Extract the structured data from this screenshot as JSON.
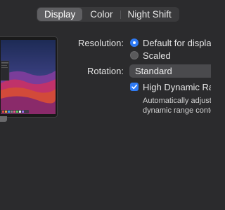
{
  "tabs": [
    {
      "label": "Display",
      "active": true
    },
    {
      "label": "Color",
      "active": false
    },
    {
      "label": "Night Shift",
      "active": false
    }
  ],
  "display": {
    "resolution_label": "Resolution:",
    "resolution_options": [
      {
        "label": "Default for display",
        "selected": true
      },
      {
        "label": "Scaled",
        "selected": false
      }
    ],
    "rotation_label": "Rotation:",
    "rotation_value": "Standard",
    "hdr_label": "High Dynamic Range",
    "hdr_checked": true,
    "hdr_description_line1": "Automatically adjust",
    "hdr_description_line2": "dynamic range conte"
  },
  "colors": {
    "accent": "#2f7bf5",
    "background": "#2b2b2d"
  }
}
